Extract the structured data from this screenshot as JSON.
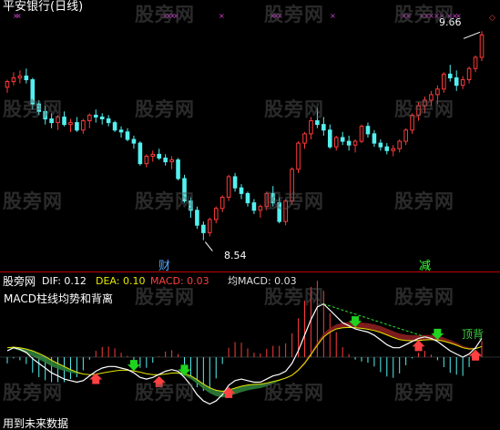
{
  "header": {
    "title": "平安银行(日线)"
  },
  "annotations": {
    "high_label": "9.66",
    "low_label": "8.54",
    "tag_cai": "财",
    "tag_jian": "减",
    "top_divergence": "顶背"
  },
  "indicator_bar": {
    "name": "股旁网",
    "dif_label": "DIF: 0.12",
    "dea_label": "DEA: 0.10",
    "macd_label": "MACD: 0.03",
    "jun_label": "均MACD: 0.03",
    "subtitle": "MACD柱线均势和背离",
    "footer": "用到未来数据"
  },
  "watermark": "股旁网",
  "colors": {
    "up": "#ff3a3a",
    "down": "#54f0f0",
    "axis": "#c00000",
    "dif": "#ffffff",
    "dea": "#e8e800",
    "title": "#ffffff",
    "red_band": "#8a1f1f",
    "green_band": "#2e7d3a"
  },
  "chart_data": [
    {
      "type": "candlestick",
      "title": "平安银行(日线)",
      "ylim": [
        8.45,
        9.72
      ],
      "high_marker": 9.66,
      "low_marker": 8.54,
      "ohlc": [
        [
          9.36,
          9.4,
          9.33,
          9.39
        ],
        [
          9.39,
          9.44,
          9.37,
          9.41
        ],
        [
          9.41,
          9.45,
          9.38,
          9.42
        ],
        [
          9.42,
          9.46,
          9.38,
          9.4
        ],
        [
          9.4,
          9.41,
          9.24,
          9.27
        ],
        [
          9.27,
          9.29,
          9.21,
          9.23
        ],
        [
          9.23,
          9.26,
          9.16,
          9.19
        ],
        [
          9.19,
          9.22,
          9.14,
          9.17
        ],
        [
          9.17,
          9.21,
          9.13,
          9.2
        ],
        [
          9.2,
          9.23,
          9.15,
          9.16
        ],
        [
          9.16,
          9.19,
          9.12,
          9.17
        ],
        [
          9.17,
          9.2,
          9.12,
          9.13
        ],
        [
          9.13,
          9.19,
          9.11,
          9.18
        ],
        [
          9.18,
          9.22,
          9.14,
          9.21
        ],
        [
          9.21,
          9.24,
          9.17,
          9.2
        ],
        [
          9.2,
          9.22,
          9.16,
          9.19
        ],
        [
          9.19,
          9.21,
          9.15,
          9.17
        ],
        [
          9.17,
          9.18,
          9.12,
          9.13
        ],
        [
          9.13,
          9.15,
          9.09,
          9.12
        ],
        [
          9.12,
          9.14,
          9.07,
          9.08
        ],
        [
          9.08,
          9.1,
          9.03,
          9.06
        ],
        [
          9.06,
          9.07,
          8.94,
          8.95
        ],
        [
          8.95,
          9.0,
          8.93,
          8.99
        ],
        [
          8.99,
          9.02,
          8.96,
          9.0
        ],
        [
          9.0,
          9.03,
          8.97,
          8.98
        ],
        [
          8.98,
          9.0,
          8.94,
          8.96
        ],
        [
          8.96,
          8.99,
          8.92,
          8.97
        ],
        [
          8.97,
          8.98,
          8.86,
          8.87
        ],
        [
          8.87,
          8.89,
          8.74,
          8.75
        ],
        [
          8.75,
          8.77,
          8.66,
          8.7
        ],
        [
          8.7,
          8.72,
          8.6,
          8.62
        ],
        [
          8.62,
          8.64,
          8.54,
          8.58
        ],
        [
          8.58,
          8.66,
          8.56,
          8.65
        ],
        [
          8.65,
          8.72,
          8.63,
          8.71
        ],
        [
          8.71,
          8.78,
          8.69,
          8.77
        ],
        [
          8.77,
          8.89,
          8.75,
          8.88
        ],
        [
          8.88,
          8.9,
          8.8,
          8.82
        ],
        [
          8.82,
          8.84,
          8.76,
          8.79
        ],
        [
          8.79,
          8.8,
          8.72,
          8.74
        ],
        [
          8.74,
          8.76,
          8.68,
          8.7
        ],
        [
          8.7,
          8.73,
          8.66,
          8.72
        ],
        [
          8.72,
          8.8,
          8.7,
          8.79
        ],
        [
          8.79,
          8.83,
          8.72,
          8.74
        ],
        [
          8.74,
          8.77,
          8.63,
          8.64
        ],
        [
          8.64,
          8.76,
          8.62,
          8.75
        ],
        [
          8.75,
          8.93,
          8.73,
          8.92
        ],
        [
          8.92,
          9.07,
          8.9,
          9.06
        ],
        [
          9.06,
          9.12,
          9.03,
          9.11
        ],
        [
          9.11,
          9.2,
          9.08,
          9.18
        ],
        [
          9.18,
          9.25,
          9.14,
          9.16
        ],
        [
          9.16,
          9.2,
          9.1,
          9.13
        ],
        [
          9.13,
          9.16,
          9.03,
          9.04
        ],
        [
          9.04,
          9.1,
          9.02,
          9.09
        ],
        [
          9.09,
          9.12,
          9.05,
          9.07
        ],
        [
          9.07,
          9.1,
          9.02,
          9.05
        ],
        [
          9.05,
          9.08,
          9.01,
          9.07
        ],
        [
          9.07,
          9.16,
          9.06,
          9.15
        ],
        [
          9.15,
          9.17,
          9.09,
          9.11
        ],
        [
          9.11,
          9.13,
          9.04,
          9.06
        ],
        [
          9.06,
          9.08,
          9.02,
          9.04
        ],
        [
          9.04,
          9.06,
          9.0,
          9.02
        ],
        [
          9.02,
          9.05,
          8.99,
          9.03
        ],
        [
          9.03,
          9.08,
          9.01,
          9.07
        ],
        [
          9.07,
          9.14,
          9.05,
          9.13
        ],
        [
          9.13,
          9.22,
          9.11,
          9.21
        ],
        [
          9.21,
          9.28,
          9.18,
          9.26
        ],
        [
          9.26,
          9.31,
          9.22,
          9.29
        ],
        [
          9.29,
          9.34,
          9.26,
          9.32
        ],
        [
          9.32,
          9.37,
          9.27,
          9.35
        ],
        [
          9.35,
          9.44,
          9.33,
          9.43
        ],
        [
          9.43,
          9.48,
          9.39,
          9.41
        ],
        [
          9.41,
          9.45,
          9.34,
          9.37
        ],
        [
          9.37,
          9.42,
          9.35,
          9.4
        ],
        [
          9.4,
          9.47,
          9.38,
          9.46
        ],
        [
          9.46,
          9.53,
          9.44,
          9.52
        ],
        [
          9.52,
          9.66,
          9.5,
          9.64
        ]
      ]
    },
    {
      "type": "line",
      "title": "MACD柱线均势和背离",
      "ylim": [
        -0.22,
        0.22
      ],
      "series": [
        {
          "name": "DIF",
          "values": [
            0.02,
            0.03,
            0.025,
            0.015,
            -0.005,
            -0.02,
            -0.035,
            -0.05,
            -0.06,
            -0.07,
            -0.075,
            -0.08,
            -0.075,
            -0.06,
            -0.045,
            -0.035,
            -0.03,
            -0.03,
            -0.035,
            -0.04,
            -0.05,
            -0.065,
            -0.07,
            -0.065,
            -0.055,
            -0.045,
            -0.04,
            -0.045,
            -0.065,
            -0.09,
            -0.12,
            -0.14,
            -0.15,
            -0.14,
            -0.12,
            -0.09,
            -0.075,
            -0.07,
            -0.075,
            -0.08,
            -0.08,
            -0.07,
            -0.06,
            -0.055,
            -0.045,
            -0.02,
            0.02,
            0.07,
            0.12,
            0.16,
            0.17,
            0.15,
            0.13,
            0.11,
            0.1,
            0.09,
            0.085,
            0.08,
            0.07,
            0.055,
            0.04,
            0.03,
            0.03,
            0.04,
            0.05,
            0.06,
            0.065,
            0.06,
            0.05,
            0.035,
            0.02,
            0.01,
            0.0,
            0.01,
            0.03,
            0.06
          ]
        },
        {
          "name": "DEA",
          "values": [
            0.03,
            0.032,
            0.03,
            0.026,
            0.02,
            0.012,
            0.002,
            -0.01,
            -0.02,
            -0.03,
            -0.04,
            -0.048,
            -0.054,
            -0.056,
            -0.055,
            -0.051,
            -0.047,
            -0.044,
            -0.042,
            -0.042,
            -0.044,
            -0.048,
            -0.053,
            -0.056,
            -0.056,
            -0.054,
            -0.051,
            -0.05,
            -0.053,
            -0.06,
            -0.072,
            -0.086,
            -0.098,
            -0.106,
            -0.109,
            -0.105,
            -0.099,
            -0.093,
            -0.089,
            -0.087,
            -0.086,
            -0.083,
            -0.078,
            -0.073,
            -0.067,
            -0.058,
            -0.042,
            -0.02,
            0.008,
            0.038,
            0.064,
            0.08,
            0.09,
            0.094,
            0.095,
            0.094,
            0.092,
            0.089,
            0.085,
            0.079,
            0.071,
            0.063,
            0.056,
            0.053,
            0.052,
            0.053,
            0.055,
            0.056,
            0.055,
            0.051,
            0.045,
            0.038,
            0.03,
            0.026,
            0.027,
            0.034
          ]
        }
      ]
    }
  ]
}
